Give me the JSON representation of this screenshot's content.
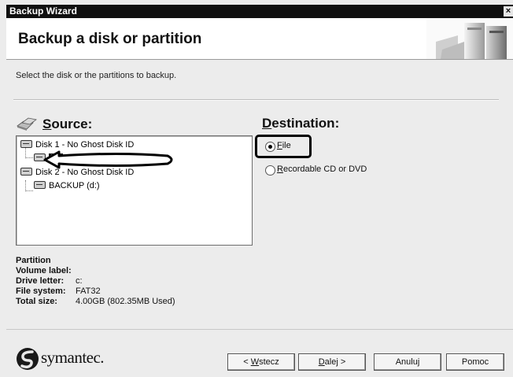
{
  "window": {
    "title": "Backup Wizard",
    "close_glyph": "×"
  },
  "header": {
    "title": "Backup a disk or partition"
  },
  "instruction": "Select the disk or the partitions to backup.",
  "source": {
    "label_u": "S",
    "label_rest": "ource:"
  },
  "destination": {
    "label_u": "D",
    "label_rest": "estination:",
    "options": [
      {
        "u": "F",
        "rest": "ile",
        "selected": true
      },
      {
        "u": "R",
        "rest": "ecordable CD or DVD",
        "selected": false
      }
    ]
  },
  "tree": {
    "disk1": "Disk 1 - No Ghost Disk ID",
    "part_c": "(c:)",
    "disk2": "Disk 2 - No Ghost Disk ID",
    "part_d": "BACKUP (d:)"
  },
  "partition_info": {
    "heading": "Partition",
    "volume_label": {
      "key": "Volume label:",
      "value": ""
    },
    "drive_letter": {
      "key": "Drive letter:",
      "value": "c:"
    },
    "file_system": {
      "key": "File system:",
      "value": "FAT32"
    },
    "total_size": {
      "key": "Total size:",
      "value": "4.00GB (802.35MB Used)"
    }
  },
  "brand": "symantec.",
  "buttons": {
    "back": {
      "pre": "< ",
      "u": "W",
      "rest": "stecz"
    },
    "next": {
      "u": "D",
      "rest": "alej >"
    },
    "cancel": "Anuluj",
    "help": "Pomoc"
  },
  "colors": {
    "title_bar": "#101010",
    "window_bg": "#ececec",
    "selection": "#111111"
  }
}
